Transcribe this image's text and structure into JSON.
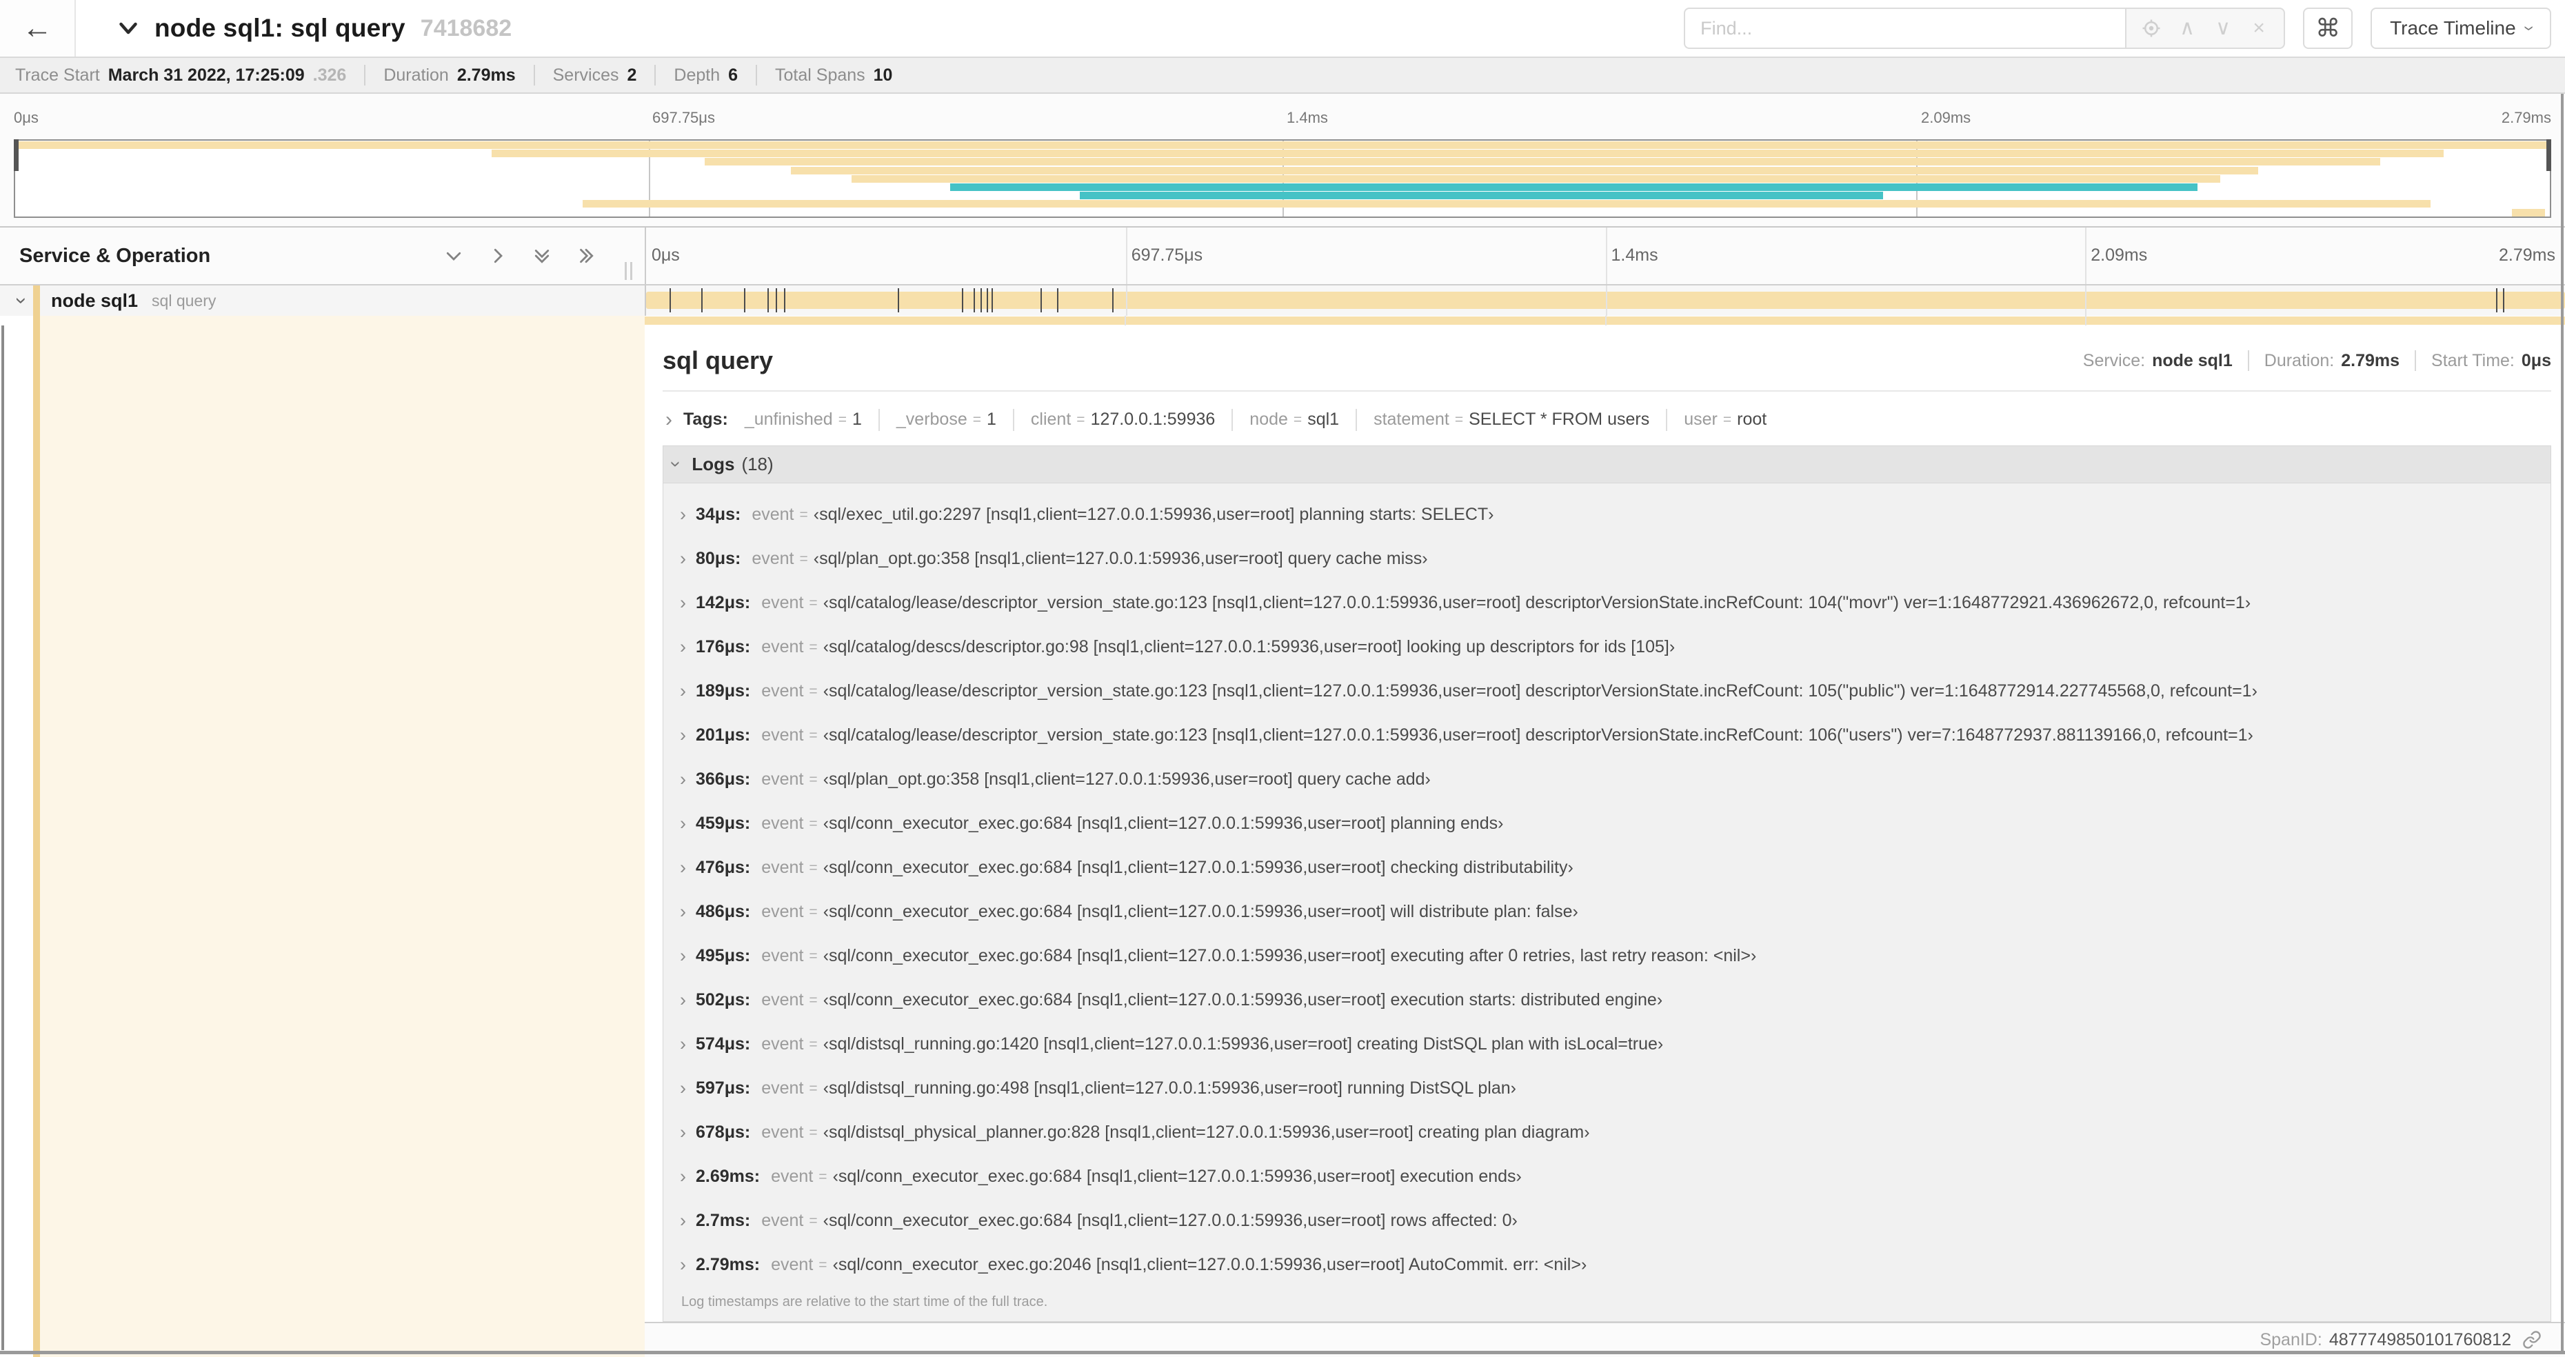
{
  "colors": {
    "tan": "#f7e0ab",
    "teal": "#45c2c6",
    "accent": "#efd191",
    "cream": "#fdf6e7"
  },
  "header": {
    "back_icon": "←",
    "title": "node sql1: sql query",
    "trace_id_short": "7418682",
    "find_placeholder": "Find...",
    "find_tools": [
      "crosshair",
      "chevron-up",
      "chevron-down",
      "close"
    ],
    "keyboard_shortcut": "⌘",
    "view_select_label": "Trace Timeline"
  },
  "summary": {
    "items": [
      {
        "label": "Trace Start",
        "value": "March 31 2022, 17:25:09",
        "suffix": ".326"
      },
      {
        "label": "Duration",
        "value": "2.79ms",
        "suffix": ""
      },
      {
        "label": "Services",
        "value": "2",
        "suffix": ""
      },
      {
        "label": "Depth",
        "value": "6",
        "suffix": ""
      },
      {
        "label": "Total Spans",
        "value": "10",
        "suffix": ""
      }
    ]
  },
  "minimap": {
    "ticks": [
      {
        "label": "0μs",
        "pct": 0
      },
      {
        "label": "697.75μs",
        "pct": 25
      },
      {
        "label": "1.4ms",
        "pct": 50
      },
      {
        "label": "2.09ms",
        "pct": 75
      },
      {
        "label": "2.79ms",
        "pct": 100
      }
    ],
    "spans": [
      {
        "start": 0,
        "end": 100,
        "color": "tan"
      },
      {
        "start": 18.8,
        "end": 95.8,
        "color": "tan"
      },
      {
        "start": 27.2,
        "end": 93.3,
        "color": "tan"
      },
      {
        "start": 30.6,
        "end": 88.5,
        "color": "tan"
      },
      {
        "start": 33.0,
        "end": 87.0,
        "color": "tan"
      },
      {
        "start": 36.9,
        "end": 86.1,
        "color": "teal"
      },
      {
        "start": 42.0,
        "end": 73.7,
        "color": "teal"
      },
      {
        "start": 22.4,
        "end": 95.3,
        "color": "tan"
      },
      {
        "start": 98.5,
        "end": 99.8,
        "color": "tan"
      }
    ]
  },
  "timeline": {
    "left_header": "Service & Operation",
    "ruler_ticks": [
      {
        "label": "0μs",
        "pct": 0
      },
      {
        "label": "697.75μs",
        "pct": 25
      },
      {
        "label": "1.4ms",
        "pct": 50
      },
      {
        "label": "2.09ms",
        "pct": 75
      },
      {
        "label": "2.79ms",
        "pct": 100
      }
    ],
    "row": {
      "service": "node sql1",
      "operation": "sql query"
    },
    "log_tick_pcts": [
      1.22,
      2.87,
      5.09,
      6.31,
      6.77,
      7.2,
      13.12,
      16.45,
      17.06,
      17.42,
      17.74,
      17.99,
      20.57,
      21.4,
      24.3,
      96.42,
      96.77,
      99.85
    ]
  },
  "detail": {
    "title": "sql query",
    "meta": [
      {
        "label": "Service:",
        "value": "node sql1"
      },
      {
        "label": "Duration:",
        "value": "2.79ms"
      },
      {
        "label": "Start Time:",
        "value": "0μs"
      }
    ],
    "tags_label": "Tags:",
    "eq": "=",
    "tags": [
      {
        "key": "_unfinished",
        "value": "1"
      },
      {
        "key": "_verbose",
        "value": "1"
      },
      {
        "key": "client",
        "value": "127.0.0.1:59936"
      },
      {
        "key": "node",
        "value": "sql1"
      },
      {
        "key": "statement",
        "value": "SELECT * FROM users"
      },
      {
        "key": "user",
        "value": "root"
      }
    ],
    "logs_label": "Logs",
    "logs_count": "(18)",
    "log_key_label": "event",
    "quote_open": "‹",
    "quote_close": "›",
    "logs": [
      {
        "time": "34μs:",
        "value": "sql/exec_util.go:2297 [nsql1,client=127.0.0.1:59936,user=root] planning starts: SELECT"
      },
      {
        "time": "80μs:",
        "value": "sql/plan_opt.go:358 [nsql1,client=127.0.0.1:59936,user=root] query cache miss"
      },
      {
        "time": "142μs:",
        "value": "sql/catalog/lease/descriptor_version_state.go:123 [nsql1,client=127.0.0.1:59936,user=root] descriptorVersionState.incRefCount: 104(\"movr\") ver=1:1648772921.436962672,0, refcount=1"
      },
      {
        "time": "176μs:",
        "value": "sql/catalog/descs/descriptor.go:98 [nsql1,client=127.0.0.1:59936,user=root] looking up descriptors for ids [105]"
      },
      {
        "time": "189μs:",
        "value": "sql/catalog/lease/descriptor_version_state.go:123 [nsql1,client=127.0.0.1:59936,user=root] descriptorVersionState.incRefCount: 105(\"public\") ver=1:1648772914.227745568,0, refcount=1"
      },
      {
        "time": "201μs:",
        "value": "sql/catalog/lease/descriptor_version_state.go:123 [nsql1,client=127.0.0.1:59936,user=root] descriptorVersionState.incRefCount: 106(\"users\") ver=7:1648772937.881139166,0, refcount=1"
      },
      {
        "time": "366μs:",
        "value": "sql/plan_opt.go:358 [nsql1,client=127.0.0.1:59936,user=root] query cache add"
      },
      {
        "time": "459μs:",
        "value": "sql/conn_executor_exec.go:684 [nsql1,client=127.0.0.1:59936,user=root] planning ends"
      },
      {
        "time": "476μs:",
        "value": "sql/conn_executor_exec.go:684 [nsql1,client=127.0.0.1:59936,user=root] checking distributability"
      },
      {
        "time": "486μs:",
        "value": "sql/conn_executor_exec.go:684 [nsql1,client=127.0.0.1:59936,user=root] will distribute plan: false"
      },
      {
        "time": "495μs:",
        "value": "sql/conn_executor_exec.go:684 [nsql1,client=127.0.0.1:59936,user=root] executing after 0 retries, last retry reason: <nil>"
      },
      {
        "time": "502μs:",
        "value": "sql/conn_executor_exec.go:684 [nsql1,client=127.0.0.1:59936,user=root] execution starts: distributed engine"
      },
      {
        "time": "574μs:",
        "value": "sql/distsql_running.go:1420 [nsql1,client=127.0.0.1:59936,user=root] creating DistSQL plan with isLocal=true"
      },
      {
        "time": "597μs:",
        "value": "sql/distsql_running.go:498 [nsql1,client=127.0.0.1:59936,user=root] running DistSQL plan"
      },
      {
        "time": "678μs:",
        "value": "sql/distsql_physical_planner.go:828 [nsql1,client=127.0.0.1:59936,user=root] creating plan diagram"
      },
      {
        "time": "2.69ms:",
        "value": "sql/conn_executor_exec.go:684 [nsql1,client=127.0.0.1:59936,user=root] execution ends"
      },
      {
        "time": "2.7ms:",
        "value": "sql/conn_executor_exec.go:684 [nsql1,client=127.0.0.1:59936,user=root] rows affected: 0"
      },
      {
        "time": "2.79ms:",
        "value": "sql/conn_executor_exec.go:2046 [nsql1,client=127.0.0.1:59936,user=root] AutoCommit. err: <nil>"
      }
    ],
    "footer": "Log timestamps are relative to the start time of the full trace.",
    "span_id_label": "SpanID:",
    "span_id": "4877749850101760812"
  }
}
